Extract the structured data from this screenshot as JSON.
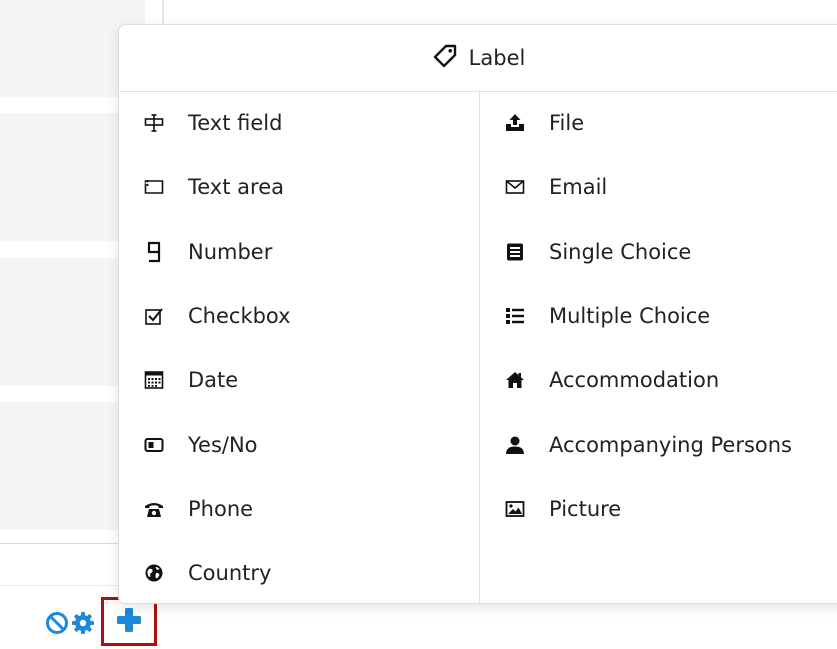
{
  "popover": {
    "header": {
      "label": "Label",
      "icon": "tag-icon"
    },
    "left_items": [
      {
        "label": "Text field",
        "icon": "text-field-icon"
      },
      {
        "label": "Text area",
        "icon": "text-area-icon"
      },
      {
        "label": "Number",
        "icon": "number-icon"
      },
      {
        "label": "Checkbox",
        "icon": "checkbox-icon"
      },
      {
        "label": "Date",
        "icon": "calendar-icon"
      },
      {
        "label": "Yes/No",
        "icon": "toggle-icon"
      },
      {
        "label": "Phone",
        "icon": "phone-icon"
      },
      {
        "label": "Country",
        "icon": "globe-icon"
      }
    ],
    "right_items": [
      {
        "label": "File",
        "icon": "upload-icon"
      },
      {
        "label": "Email",
        "icon": "envelope-icon"
      },
      {
        "label": "Single Choice",
        "icon": "single-choice-icon"
      },
      {
        "label": "Multiple Choice",
        "icon": "list-icon"
      },
      {
        "label": "Accommodation",
        "icon": "home-icon"
      },
      {
        "label": "Accompanying Persons",
        "icon": "user-icon"
      },
      {
        "label": "Picture",
        "icon": "image-icon"
      }
    ]
  },
  "toolbar": {
    "icons": [
      "ban-icon",
      "gear-icon",
      "plus-icon"
    ],
    "accent_color": "#1e88d9",
    "highlight_color": "#b10f0f"
  }
}
